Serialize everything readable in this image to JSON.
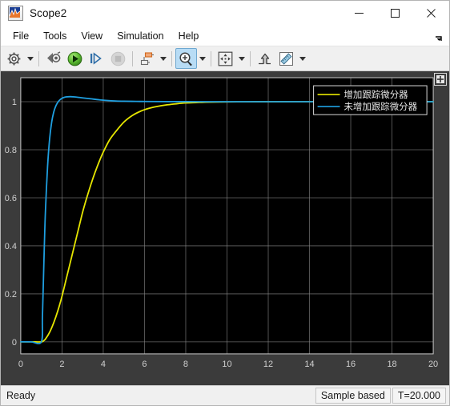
{
  "window": {
    "title": "Scope2",
    "icon": "scope-waveform-icon",
    "controls": [
      {
        "name": "minimize-button",
        "glyph": "minimize-icon"
      },
      {
        "name": "maximize-button",
        "glyph": "maximize-icon"
      },
      {
        "name": "close-button",
        "glyph": "close-icon"
      }
    ]
  },
  "menubar": {
    "items": [
      {
        "label": "File"
      },
      {
        "label": "Tools"
      },
      {
        "label": "View"
      },
      {
        "label": "Simulation"
      },
      {
        "label": "Help"
      }
    ],
    "overflow_icon": "menu-overflow-arrow-icon"
  },
  "toolbar": {
    "items": [
      {
        "name": "configuration-properties-button",
        "icon": "gear-icon",
        "has_dropdown": true,
        "state": "normal"
      },
      {
        "name": "run-back-button",
        "icon": "rewind-step-icon",
        "has_dropdown": false,
        "state": "normal"
      },
      {
        "name": "run-button",
        "icon": "play-green-icon",
        "has_dropdown": false,
        "state": "normal"
      },
      {
        "name": "step-forward-button",
        "icon": "step-forward-icon",
        "has_dropdown": false,
        "state": "normal"
      },
      {
        "name": "stop-button",
        "icon": "stop-icon",
        "has_dropdown": false,
        "state": "disabled"
      },
      {
        "name": "signal-selection-button",
        "icon": "signal-selector-icon",
        "has_dropdown": true,
        "state": "normal"
      },
      {
        "name": "zoom-in-button",
        "icon": "zoom-in-magnifier-icon",
        "has_dropdown": true,
        "state": "active"
      },
      {
        "name": "fit-to-view-button",
        "icon": "fit-to-view-icon",
        "has_dropdown": true,
        "state": "normal"
      },
      {
        "name": "scale-axes-limits-button",
        "icon": "scale-axes-arrow-icon",
        "has_dropdown": false,
        "state": "normal"
      },
      {
        "name": "cursor-measurements-button",
        "icon": "ruler-icon",
        "has_dropdown": true,
        "state": "normal"
      }
    ]
  },
  "scope": {
    "pin_icon": "pin-axes-icon"
  },
  "statusbar": {
    "ready_label": "Ready",
    "frame_mode": "Sample based",
    "sim_time": "T=20.000"
  },
  "chart_data": {
    "type": "line",
    "title": "",
    "xlabel": "",
    "ylabel": "",
    "xlim": [
      0,
      20
    ],
    "ylim": [
      -0.05,
      1.1
    ],
    "xticks": [
      0,
      2,
      4,
      6,
      8,
      10,
      12,
      14,
      16,
      18,
      20
    ],
    "yticks": [
      0,
      0.2,
      0.4,
      0.6,
      0.8,
      1
    ],
    "xticklabels": [
      "0",
      "2",
      "4",
      "6",
      "8",
      "10",
      "12",
      "14",
      "16",
      "18",
      "20"
    ],
    "yticklabels": [
      "0",
      "0.2",
      "0.4",
      "0.6",
      "0.8",
      "1"
    ],
    "grid": true,
    "background": "#000000",
    "grid_color": "#8a8a8a",
    "legend_position": "upper right",
    "series": [
      {
        "name": "增加跟踪微分器",
        "color": "#e6e600",
        "x": [
          0,
          0.5,
          1.0,
          1.1,
          1.2,
          1.4,
          1.6,
          1.8,
          2.0,
          2.2,
          2.4,
          2.6,
          2.8,
          3.0,
          3.2,
          3.4,
          3.6,
          3.8,
          4.0,
          4.3,
          4.6,
          5.0,
          5.4,
          5.8,
          6.2,
          6.6,
          7.0,
          7.5,
          8.0,
          8.5,
          9.0,
          10.0,
          11.0,
          12.0,
          14.0,
          16.0,
          18.0,
          20.0
        ],
        "y": [
          0,
          0,
          0,
          0.004,
          0.012,
          0.04,
          0.08,
          0.13,
          0.19,
          0.26,
          0.33,
          0.4,
          0.47,
          0.54,
          0.6,
          0.655,
          0.705,
          0.75,
          0.79,
          0.84,
          0.875,
          0.915,
          0.942,
          0.96,
          0.972,
          0.98,
          0.986,
          0.991,
          0.995,
          0.9965,
          0.998,
          0.9993,
          0.9997,
          0.9999,
          1.0,
          1.0,
          1.0,
          1.0
        ]
      },
      {
        "name": "未增加跟踪微分器",
        "color": "#1f9fe0",
        "x": [
          0,
          0.5,
          1.0,
          1.05,
          1.1,
          1.15,
          1.2,
          1.3,
          1.4,
          1.5,
          1.6,
          1.7,
          1.8,
          1.9,
          2.0,
          2.1,
          2.2,
          2.4,
          2.6,
          2.8,
          3.0,
          3.4,
          3.8,
          4.2,
          4.6,
          5.0,
          5.6,
          6.2,
          7.0,
          8.0,
          9.0,
          10.0,
          12.0,
          14.0,
          16.0,
          18.0,
          20.0
        ],
        "y": [
          0,
          0,
          0,
          0.1,
          0.26,
          0.42,
          0.55,
          0.73,
          0.845,
          0.915,
          0.957,
          0.982,
          0.998,
          1.008,
          1.014,
          1.018,
          1.02,
          1.021,
          1.02,
          1.018,
          1.016,
          1.012,
          1.008,
          1.005,
          1.003,
          1.002,
          1.0012,
          1.0008,
          1.0004,
          1.0002,
          1.0001,
          1.0,
          1.0,
          1.0,
          1.0,
          1.0,
          1.0
        ]
      }
    ]
  }
}
